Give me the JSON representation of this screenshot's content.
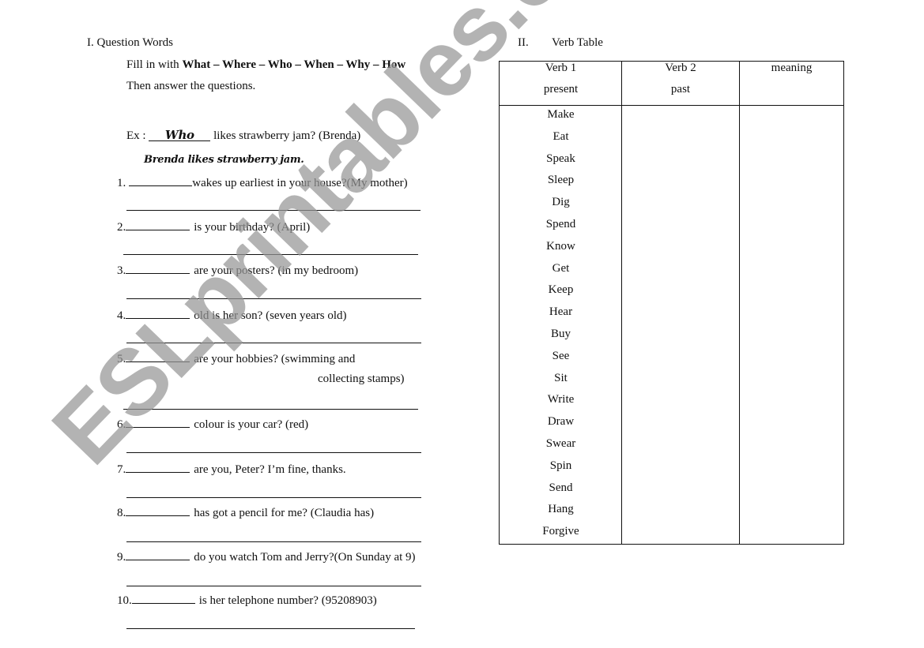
{
  "section1": {
    "title": "I. Question Words",
    "instruction_prefix": "Fill in with ",
    "question_words": "What – Where – Who – When – Why – How",
    "instruction2": "Then answer the questions.",
    "example": {
      "prefix": "Ex :",
      "answer_word": "Who",
      "question": "likes strawberry jam? (Brenda)",
      "answer_sentence": "Brenda likes strawberry jam."
    },
    "questions": [
      {
        "num": "1.",
        "text": "wakes up earliest in your house?(My mother)"
      },
      {
        "num": "2.",
        "text": "is your birthday? (April)"
      },
      {
        "num": "3.",
        "text": "are your posters? (in my bedroom)"
      },
      {
        "num": "4.",
        "text": "old is her son? (seven years old)"
      },
      {
        "num": "5.",
        "text": "are your hobbies? (swimming and",
        "text2": "collecting stamps)"
      },
      {
        "num": "6.",
        "text": "colour is your car? (red)"
      },
      {
        "num": "7.",
        "text": "are you, Peter? I’m fine, thanks."
      },
      {
        "num": "8.",
        "text": "has got a pencil for me? (Claudia has)"
      },
      {
        "num": "9.",
        "text": "do you watch Tom and Jerry?(On Sunday at 9)"
      },
      {
        "num": "10.",
        "text": "is her telephone number? (95208903)"
      }
    ]
  },
  "section2": {
    "numeral": "II.",
    "title": "Verb Table",
    "headers": [
      {
        "line1": "Verb 1",
        "line2": "present"
      },
      {
        "line1": "Verb 2",
        "line2": "past"
      },
      {
        "line1": "meaning",
        "line2": ""
      }
    ],
    "verbs": [
      "Make",
      "Eat",
      "Speak",
      "Sleep",
      "Dig",
      "Spend",
      "Know",
      "Get",
      "Keep",
      "Hear",
      "Buy",
      "See",
      "Sit",
      "Write",
      "Draw",
      "Swear",
      "Spin",
      "Send",
      "Hang",
      "Forgive"
    ]
  },
  "watermark": "ESLprintables.com"
}
